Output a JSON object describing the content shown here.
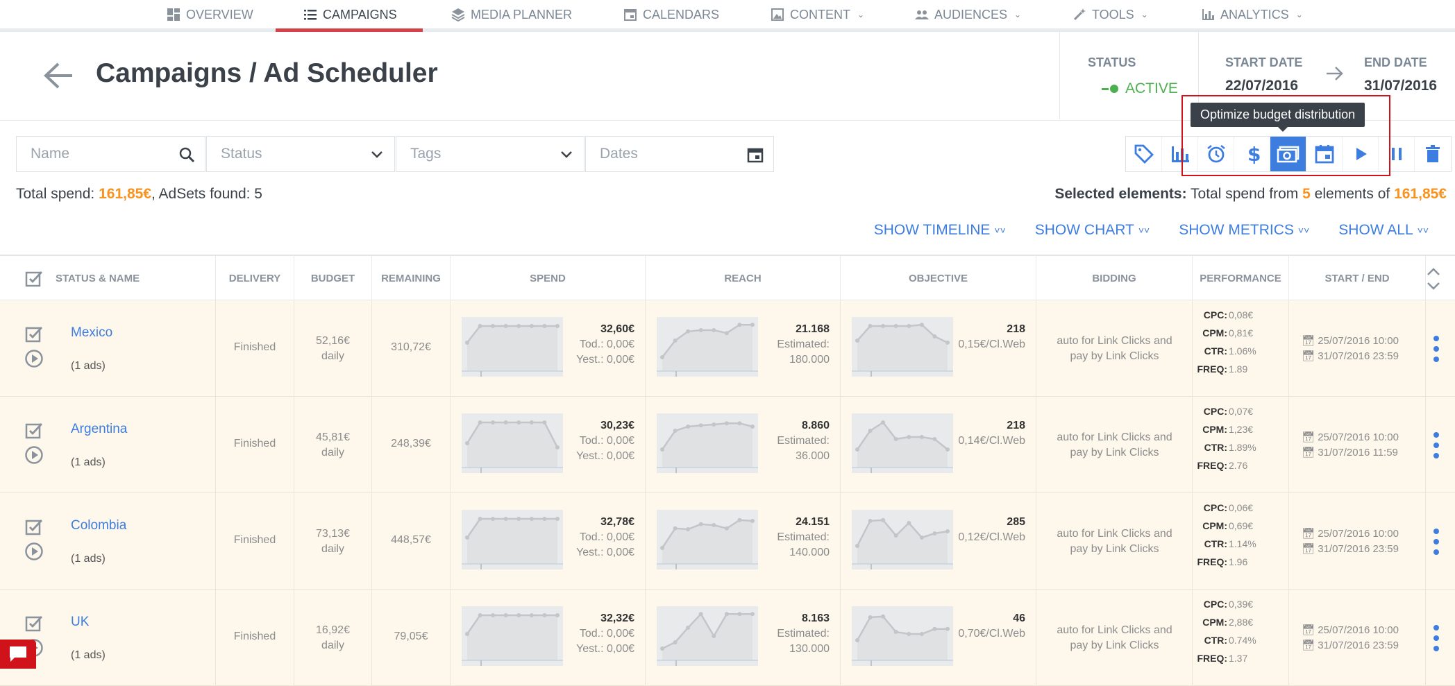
{
  "nav": {
    "items": [
      {
        "label": "OVERVIEW",
        "icon": "dashboard-icon",
        "caret": false
      },
      {
        "label": "CAMPAIGNS",
        "icon": "list-icon",
        "caret": false,
        "active": true
      },
      {
        "label": "MEDIA PLANNER",
        "icon": "layers-icon",
        "caret": false
      },
      {
        "label": "CALENDARS",
        "icon": "calendar-icon",
        "caret": false
      },
      {
        "label": "CONTENT",
        "icon": "image-icon",
        "caret": true
      },
      {
        "label": "AUDIENCES",
        "icon": "people-icon",
        "caret": true
      },
      {
        "label": "TOOLS",
        "icon": "wand-icon",
        "caret": true
      },
      {
        "label": "ANALYTICS",
        "icon": "bar-chart-icon",
        "caret": true
      }
    ]
  },
  "header": {
    "title": "Campaigns / Ad Scheduler",
    "status_label": "STATUS",
    "status_value": "ACTIVE",
    "start_label": "START DATE",
    "start_value": "22/07/2016",
    "end_label": "END DATE",
    "end_value": "31/07/2016"
  },
  "filters": {
    "name_placeholder": "Name",
    "status_placeholder": "Status",
    "tags_placeholder": "Tags",
    "dates_placeholder": "Dates"
  },
  "toolbar": {
    "tooltip": "Optimize budget distribution",
    "buttons": [
      "tag-icon",
      "bar-chart-icon",
      "alarm-icon",
      "dollar-icon",
      "money-icon",
      "calendar-icon",
      "play-icon",
      "pause-icon",
      "trash-icon"
    ]
  },
  "summary": {
    "total_label": "Total spend:",
    "total_value": "161,85€",
    "adsets_label": ", AdSets found:",
    "adsets_value": "5",
    "selected_label": "Selected elements:",
    "selected_text_1": "Total spend from",
    "selected_count": "5",
    "selected_text_2": "elements of",
    "selected_total": "161,85€"
  },
  "show_links": [
    "SHOW TIMELINE",
    "SHOW CHART",
    "SHOW METRICS",
    "SHOW ALL"
  ],
  "columns": [
    "STATUS & NAME",
    "DELIVERY",
    "BUDGET",
    "REMAINING",
    "SPEND",
    "REACH",
    "OBJECTIVE",
    "BIDDING",
    "PERFORMANCE",
    "START / END"
  ],
  "rows": [
    {
      "name": "Mexico",
      "ads": "(1 ads)",
      "delivery": "Finished",
      "budget": "52,16€",
      "budget_period": "daily",
      "remaining": "310,72€",
      "spend": "32,60€",
      "spend_tod": "Tod.: 0,00€",
      "spend_yest": "Yest.: 0,00€",
      "reach": "21.168",
      "reach_est_label": "Estimated:",
      "reach_est": "180.000",
      "objective": "218",
      "objective_sub": "0,15€/Cl.Web",
      "bidding": "auto for Link Clicks and pay by Link Clicks",
      "cpc": "0,08€",
      "cpm": "0,81€",
      "ctr": "1.06%",
      "freq": "1.89",
      "start": "25/07/2016 10:00",
      "end": "31/07/2016 23:59",
      "spend_trend": [
        0.55,
        0.95,
        0.95,
        0.95,
        0.95,
        0.95,
        0.95,
        0.95
      ],
      "reach_trend": [
        0.2,
        0.6,
        0.82,
        0.85,
        0.85,
        0.78,
        0.98,
        0.98
      ],
      "objective_trend": [
        0.6,
        0.95,
        0.95,
        0.95,
        0.95,
        0.98,
        0.7,
        0.55
      ]
    },
    {
      "name": "Argentina",
      "ads": "(1 ads)",
      "delivery": "Finished",
      "budget": "45,81€",
      "budget_period": "daily",
      "remaining": "248,39€",
      "spend": "30,23€",
      "spend_tod": "Tod.: 0,00€",
      "spend_yest": "Yest.: 0,00€",
      "reach": "8.860",
      "reach_est_label": "Estimated:",
      "reach_est": "36.000",
      "objective": "218",
      "objective_sub": "0,14€/Cl.Web",
      "bidding": "auto for Link Clicks and pay by Link Clicks",
      "cpc": "0,07€",
      "cpm": "1,23€",
      "ctr": "1.89%",
      "freq": "2.76",
      "start": "25/07/2016 10:00",
      "end": "31/07/2016 11:59",
      "spend_trend": [
        0.45,
        0.95,
        0.95,
        0.95,
        0.95,
        0.95,
        0.95,
        0.35
      ],
      "reach_trend": [
        0.3,
        0.75,
        0.85,
        0.88,
        0.9,
        0.93,
        0.93,
        0.85
      ],
      "objective_trend": [
        0.3,
        0.75,
        0.95,
        0.55,
        0.6,
        0.6,
        0.55,
        0.3
      ]
    },
    {
      "name": "Colombia",
      "ads": "(1 ads)",
      "delivery": "Finished",
      "budget": "73,13€",
      "budget_period": "daily",
      "remaining": "448,57€",
      "spend": "32,78€",
      "spend_tod": "Tod.: 0,00€",
      "spend_yest": "Yest.: 0,00€",
      "reach": "24.151",
      "reach_est_label": "Estimated:",
      "reach_est": "140.000",
      "objective": "285",
      "objective_sub": "0,12€/Cl.Web",
      "bidding": "auto for Link Clicks and pay by Link Clicks",
      "cpc": "0,06€",
      "cpm": "0,69€",
      "ctr": "1.14%",
      "freq": "1.96",
      "start": "25/07/2016 10:00",
      "end": "31/07/2016 23:59",
      "spend_trend": [
        0.5,
        0.95,
        0.95,
        0.95,
        0.95,
        0.95,
        0.95,
        0.95
      ],
      "reach_trend": [
        0.25,
        0.72,
        0.7,
        0.82,
        0.8,
        0.72,
        0.92,
        0.9
      ],
      "objective_trend": [
        0.3,
        0.9,
        0.92,
        0.55,
        0.85,
        0.5,
        0.6,
        0.65
      ]
    },
    {
      "name": "UK",
      "ads": "(1 ads)",
      "delivery": "Finished",
      "budget": "16,92€",
      "budget_period": "daily",
      "remaining": "79,05€",
      "spend": "32,32€",
      "spend_tod": "Tod.: 0,00€",
      "spend_yest": "Yest.: 0,00€",
      "reach": "8.163",
      "reach_est_label": "Estimated:",
      "reach_est": "130.000",
      "objective": "46",
      "objective_sub": "0,70€/Cl.Web",
      "bidding": "auto for Link Clicks and pay by Link Clicks",
      "cpc": "0,39€",
      "cpm": "2,88€",
      "ctr": "0.74%",
      "freq": "1.37",
      "start": "25/07/2016 10:00",
      "end": "31/07/2016 23:59",
      "spend_trend": [
        0.5,
        0.95,
        0.95,
        0.95,
        0.95,
        0.95,
        0.95,
        0.95
      ],
      "reach_trend": [
        0.15,
        0.3,
        0.65,
        0.98,
        0.45,
        0.98,
        0.98,
        0.98
      ],
      "objective_trend": [
        0.35,
        0.9,
        0.92,
        0.55,
        0.5,
        0.5,
        0.62,
        0.62
      ]
    }
  ],
  "colors": {
    "accent": "#3d7de0",
    "orange": "#f7931e",
    "active": "#4caf50",
    "red": "#d0121b",
    "row_bg": "#fdf7ec"
  }
}
